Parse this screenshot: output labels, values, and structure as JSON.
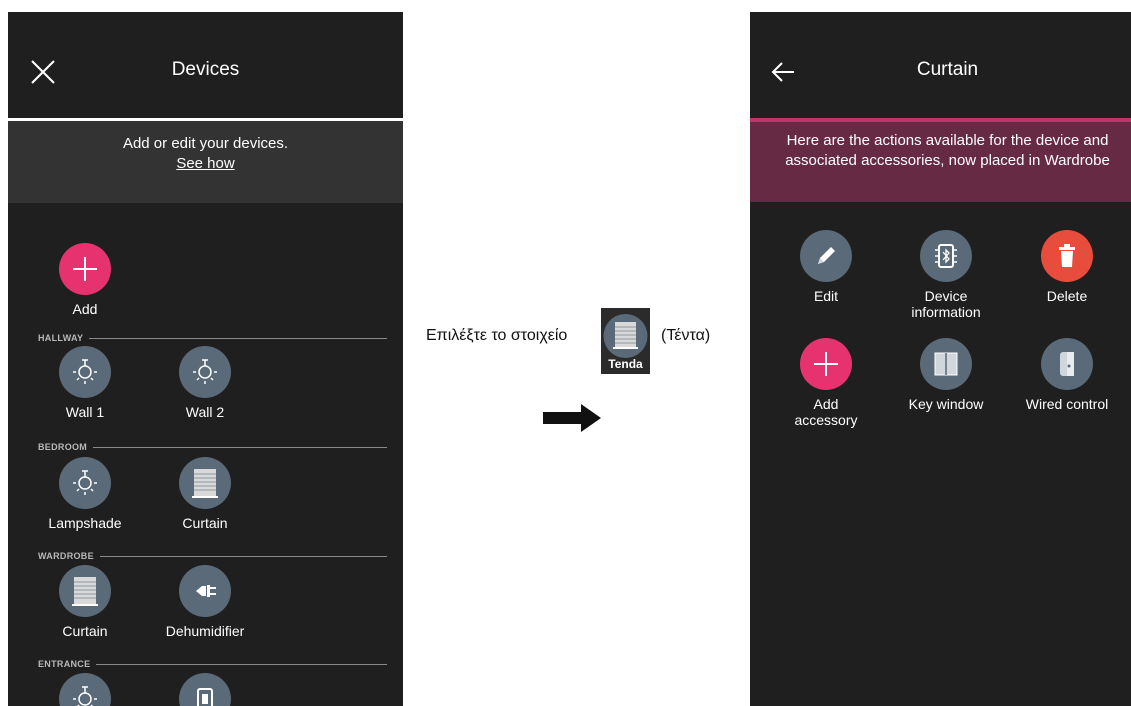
{
  "left": {
    "title": "Devices",
    "info_line1": "Add or edit your devices.",
    "info_link": "See how",
    "add_label": "Add",
    "sections": {
      "hallway": "HALLWAY",
      "bedroom": "BEDROOM",
      "wardrobe": "WARDROBE",
      "entrance": "ENTRANCE"
    },
    "devices": {
      "wall1": "Wall 1",
      "wall2": "Wall 2",
      "lampshade": "Lampshade",
      "curtain_bedroom": "Curtain",
      "curtain_wardrobe": "Curtain",
      "dehumidifier": "Dehumidifier"
    }
  },
  "middle": {
    "instruction": "Επιλέξτε το στοιχείο",
    "icon_label": "Tenda",
    "suffix": "(Τέντα)"
  },
  "right": {
    "title": "Curtain",
    "info": "Here are the actions available for the device and associated accessories, now placed in Wardrobe",
    "actions": {
      "edit": "Edit",
      "device_info": "Device information",
      "delete": "Delete",
      "add_accessory": "Add accessory",
      "key_window": "Key window",
      "wired_control": "Wired control"
    }
  },
  "colors": {
    "screen_bg": "#1f1f1f",
    "info_bar": "#333333",
    "accent_pink": "#e6336f",
    "header_strip": "#c2336a",
    "actions_banner": "#662a45",
    "icon_circle": "#5a6a78",
    "delete_red": "#e74c3c"
  }
}
